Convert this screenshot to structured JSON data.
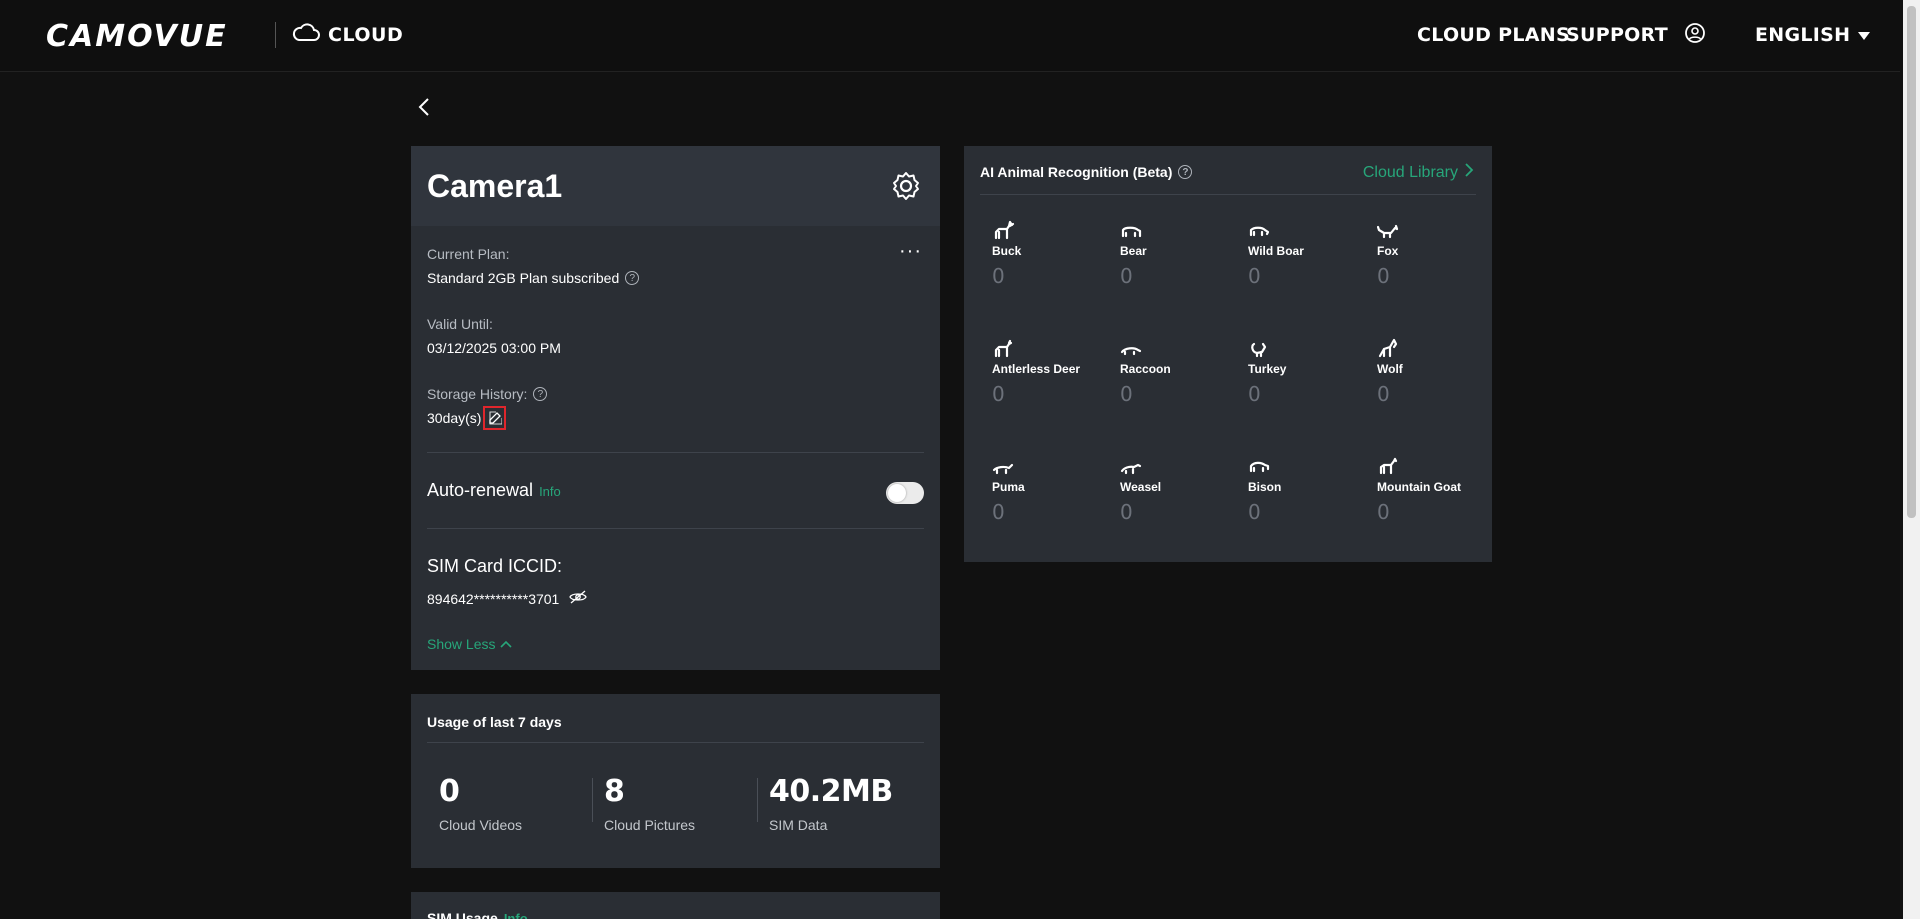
{
  "header": {
    "logo": "CAMOVUE",
    "brand_label": "CLOUD",
    "nav_cloud_plans": "CLOUD PLANS",
    "nav_support": "SUPPORT",
    "language": "ENGLISH"
  },
  "camera": {
    "name": "Camera1",
    "more": "···",
    "current_plan_label": "Current Plan:",
    "current_plan_value": "Standard 2GB Plan subscribed",
    "valid_until_label": "Valid Until:",
    "valid_until_value": "03/12/2025 03:00 PM",
    "storage_history_label": "Storage History:",
    "storage_history_value": "30day(s)",
    "auto_renewal_label": "Auto-renewal",
    "auto_renewal_info": "Info",
    "auto_renewal_enabled": false,
    "sim_label": "SIM Card ICCID:",
    "sim_value": "894642**********3701",
    "show_less": "Show Less"
  },
  "usage": {
    "title": "Usage of last 7 days",
    "stats": [
      {
        "value": "0",
        "label": "Cloud Videos"
      },
      {
        "value": "8",
        "label": "Cloud Pictures"
      },
      {
        "value": "40.2MB",
        "label": "SIM Data"
      }
    ]
  },
  "sim_usage": {
    "title": "SIM Usage",
    "info": "Info"
  },
  "ai": {
    "title": "AI Animal Recognition (Beta)",
    "library_link": "Cloud Library",
    "animals": [
      {
        "name": "Buck",
        "count": "0",
        "icon": "buck-icon"
      },
      {
        "name": "Bear",
        "count": "0",
        "icon": "bear-icon"
      },
      {
        "name": "Wild Boar",
        "count": "0",
        "icon": "wild-boar-icon"
      },
      {
        "name": "Fox",
        "count": "0",
        "icon": "fox-icon"
      },
      {
        "name": "Antlerless Deer",
        "count": "0",
        "icon": "antlerless-deer-icon"
      },
      {
        "name": "Raccoon",
        "count": "0",
        "icon": "raccoon-icon"
      },
      {
        "name": "Turkey",
        "count": "0",
        "icon": "turkey-icon"
      },
      {
        "name": "Wolf",
        "count": "0",
        "icon": "wolf-icon"
      },
      {
        "name": "Puma",
        "count": "0",
        "icon": "puma-icon"
      },
      {
        "name": "Weasel",
        "count": "0",
        "icon": "weasel-icon"
      },
      {
        "name": "Bison",
        "count": "0",
        "icon": "bison-icon"
      },
      {
        "name": "Mountain Goat",
        "count": "0",
        "icon": "mountain-goat-icon"
      }
    ]
  },
  "colors": {
    "background": "#111111",
    "card": "#2a2e34",
    "accent_green": "#27a67a",
    "highlight_red": "#e0262c"
  }
}
